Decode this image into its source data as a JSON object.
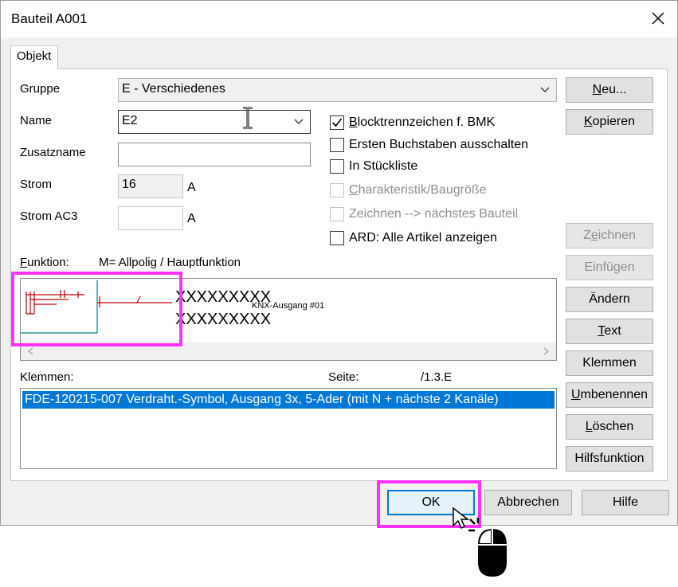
{
  "window": {
    "title": "Bauteil A001"
  },
  "tabs": [
    {
      "label": "Objekt"
    }
  ],
  "form": {
    "gruppe_label": "Gruppe",
    "gruppe_value": "E - Verschiedenes",
    "name_label": "Name",
    "name_value": "E2",
    "zusatzname_label": "Zusatzname",
    "zusatzname_value": "",
    "strom_label": "Strom",
    "strom_value": "16",
    "strom_unit": "A",
    "strom_ac3_label": "Strom AC3",
    "strom_ac3_value": "",
    "strom_ac3_unit": "A"
  },
  "checkboxes": [
    {
      "label": "Blocktrennzeichen f. BMK",
      "checked": true,
      "disabled": false
    },
    {
      "label": "Ersten Buchstaben ausschalten",
      "checked": false,
      "disabled": false
    },
    {
      "label": "In Stückliste",
      "checked": false,
      "disabled": false
    },
    {
      "label": "Charakteristik/Baugröße",
      "checked": false,
      "disabled": true
    },
    {
      "label": "Zeichnen --> nächstes Bauteil",
      "checked": false,
      "disabled": true
    },
    {
      "label": "ARD: Alle Artikel anzeigen",
      "checked": false,
      "disabled": false
    }
  ],
  "funktion": {
    "label": "Funktion:",
    "value": "M= Allpolig / Hauptfunktion",
    "preview_text_1": "XXXXXXXXX",
    "preview_text_2": "XXXXXXXXX",
    "preview_caption": "KNX-Ausgang #01"
  },
  "klemmen": {
    "label": "Klemmen:",
    "seite_label": "Seite:",
    "seite_value": "/1.3.E",
    "items": [
      "FDE-120215-007  Verdraht.-Symbol, Ausgang 3x, 5-Ader (mit N + nächste 2 Kanäle)"
    ]
  },
  "side_buttons": {
    "neu": "Neu...",
    "kopieren": "Kopieren",
    "zeichnen": "Zeichnen",
    "einfuegen": "Einfügen",
    "aendern": "Ändern",
    "text": "Text",
    "klemmen": "Klemmen",
    "umbenennen": "Umbenennen",
    "loeschen": "Löschen",
    "hilfsfunktion": "Hilfsfunktion"
  },
  "footer_buttons": {
    "ok": "OK",
    "abbrechen": "Abbrechen",
    "hilfe": "Hilfe"
  },
  "colors": {
    "accent": "#0078d7",
    "highlight": "#ff33ff",
    "symbol_red": "#c00000",
    "symbol_teal": "#008080"
  }
}
